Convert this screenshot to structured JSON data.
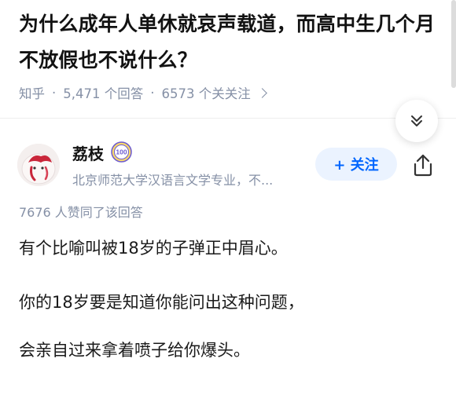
{
  "question": {
    "title": "为什么成年人单休就哀声载道，而高中生几个月不放假也不说什么？",
    "source": "知乎",
    "answers_count": "5,471 个回答",
    "followers_count": "6573 个关关注"
  },
  "author": {
    "name": "荔枝",
    "badge_text": "100",
    "bio": "北京师范大学汉语言文学专业，不...",
    "follow_label": "+ 关注"
  },
  "answer": {
    "likes_text": "7676 人赞同了该回答",
    "paragraphs": [
      "有个比喻叫被18岁的子弹正中眉心。",
      "你的18岁要是知道你能问出这种问题，",
      "会亲自过来拿着喷子给你爆头。"
    ]
  },
  "colors": {
    "accent": "#0066ff",
    "meta": "#8590a6",
    "follow_bg": "#ebf3ff"
  }
}
